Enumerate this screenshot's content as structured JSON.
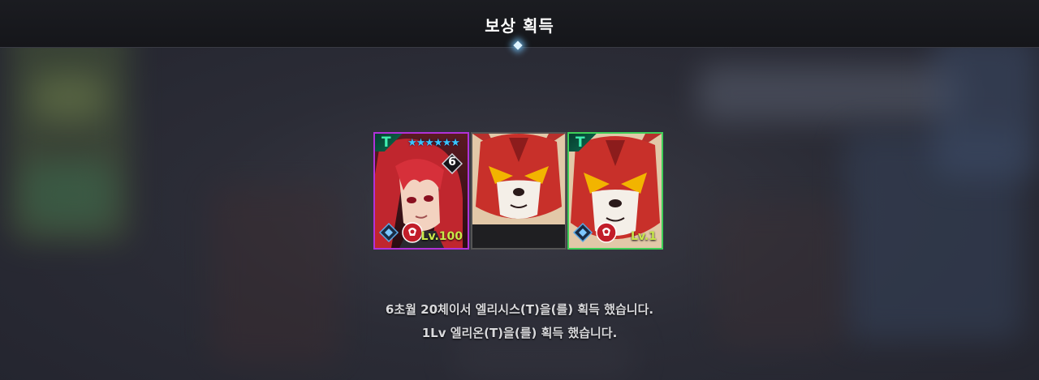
{
  "header": {
    "title": "보상 획득"
  },
  "rewards": [
    {
      "tier": "T",
      "stars": "★★★★★★",
      "star_count": 6,
      "rank": "6",
      "level": "Lv.100",
      "border_color": "#b032d8"
    },
    {
      "tier": "",
      "level": "",
      "border_color": "#555555"
    },
    {
      "tier": "T",
      "level": "Lv.1",
      "border_color": "#3fcf58"
    }
  ],
  "messages": [
    "6초월 20체이서 엘리시스(T)을(를) 획득 했습니다.",
    "1Lv 엘리온(T)을(를) 획득 했습니다."
  ],
  "colors": {
    "tier_text": "#3ff0b0",
    "level_text": "#c8e84a",
    "star": "#39c6ff"
  }
}
